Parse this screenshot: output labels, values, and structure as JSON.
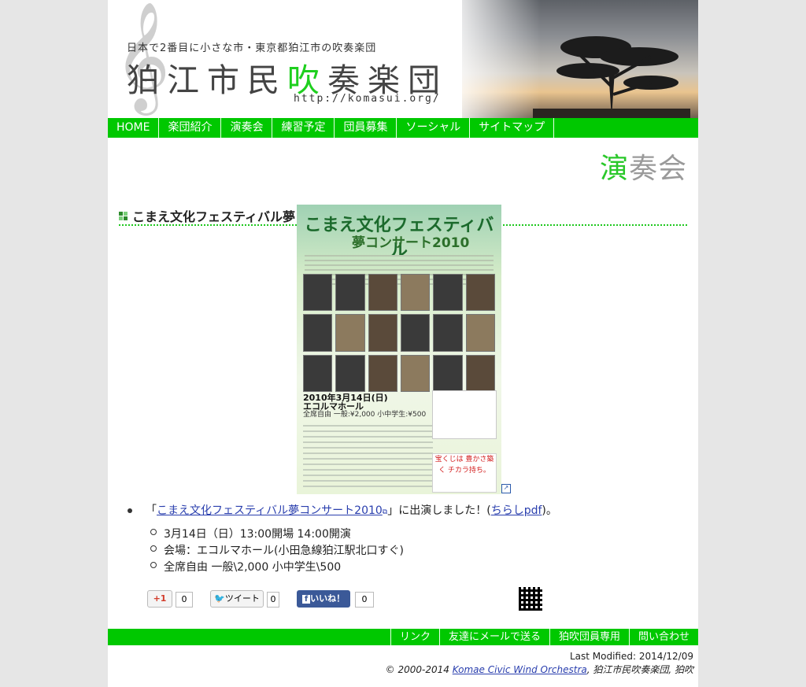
{
  "header": {
    "tagline": "日本で2番目に小さな市・東京都狛江市の吹奏楽団",
    "logo_part1": "狛江市民",
    "logo_green": "吹",
    "logo_part2": "奏楽団",
    "url": "http://komasui.org/",
    "clef": "𝄞"
  },
  "nav": {
    "items": [
      "HOME",
      "楽団紹介",
      "演奏会",
      "練習予定",
      "団員募集",
      "ソーシャル",
      "サイトマップ"
    ]
  },
  "page_heading": {
    "green": "演",
    "rest": "奏会"
  },
  "article": {
    "title": "こまえ文化フェスティバル夢コンサート2010",
    "poster_title": "こまえ文化フェスティバル",
    "poster_subtitle": "夢コンサート2010",
    "poster_date": "2010年3月14日(日)",
    "poster_venue": "エコルマホール",
    "poster_price": "全席自由 一般:¥2,000 小中学生:¥500",
    "poster_badge": "宝くじは 豊かさ築く チカラ持ち。",
    "line_open": "「",
    "line_link": "こまえ文化フェスティバル夢コンサート2010",
    "line_mid": "」に出演しました！(",
    "line_pdf": "ちらしpdf",
    "line_end": ")。",
    "details": [
      "3月14日（日）13:00開場 14:00開演",
      "会場：エコルマホール(小田急線狛江駅北口すぐ)",
      "全席自由 一般\\2,000 小中学生\\500"
    ]
  },
  "social": {
    "gplus": "+1",
    "gplus_count": "0",
    "tweet": "ツイート",
    "tweet_count": "0",
    "like": "いいね！",
    "like_count": "0",
    "qr_icon": "qr-code-icon"
  },
  "footer_nav": {
    "items": [
      "リンク",
      "友達にメールで送る",
      "狛吹団員専用",
      "問い合わせ"
    ]
  },
  "footer": {
    "last_modified": "Last Modified: 2014/12/09",
    "copyright_prefix": "© 2000-2014 ",
    "org_link": "Komae Civic Wind Orchestra",
    "copyright_suffix": ", 狛江市民吹奏楽団, 狛吹"
  },
  "colors": {
    "accent": "#00c800",
    "link": "#2a3fae"
  }
}
